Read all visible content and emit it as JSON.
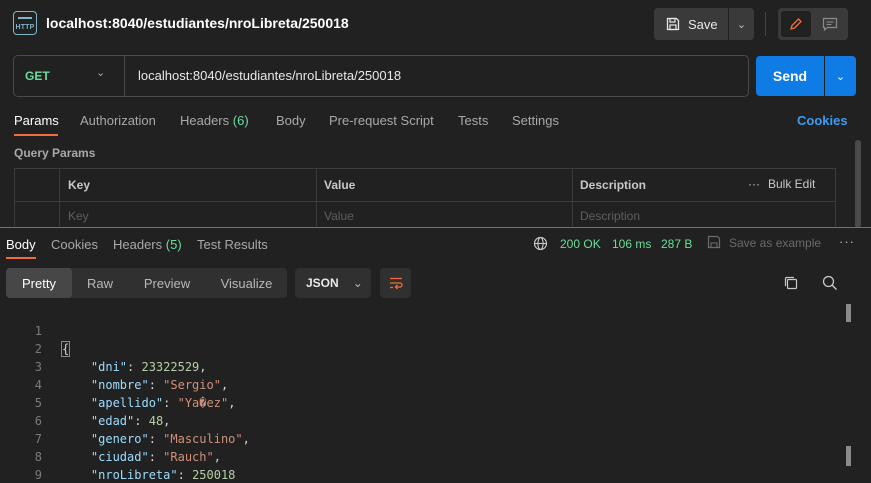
{
  "header": {
    "title": "localhost:8040/estudiantes/nroLibreta/250018",
    "save_label": "Save"
  },
  "request": {
    "method": "GET",
    "url": "localhost:8040/estudiantes/nroLibreta/250018",
    "send_label": "Send"
  },
  "request_tabs": {
    "params": "Params",
    "authorization": "Authorization",
    "headers": "Headers",
    "headers_count": "(6)",
    "body": "Body",
    "prerequest": "Pre-request Script",
    "tests": "Tests",
    "settings": "Settings",
    "cookies": "Cookies"
  },
  "query_params": {
    "label": "Query Params",
    "columns": {
      "key": "Key",
      "value": "Value",
      "description": "Description"
    },
    "bulk_edit": "Bulk Edit",
    "placeholders": {
      "key": "Key",
      "value": "Value",
      "description": "Description"
    }
  },
  "response_tabs": {
    "body": "Body",
    "cookies": "Cookies",
    "headers": "Headers",
    "headers_count": "(5)",
    "test_results": "Test Results"
  },
  "response_status": {
    "status": "200 OK",
    "time": "106 ms",
    "size": "287 B",
    "save_example": "Save as example"
  },
  "format": {
    "pretty": "Pretty",
    "raw": "Raw",
    "preview": "Preview",
    "visualize": "Visualize",
    "language": "JSON"
  },
  "response_body": {
    "line_numbers": [
      "1",
      "2",
      "3",
      "4",
      "5",
      "6",
      "7",
      "8",
      "9"
    ],
    "open_brace": "{",
    "close_brace": "}",
    "fields": [
      {
        "key": "\"dni\"",
        "value": "23322529",
        "type": "number",
        "comma": ","
      },
      {
        "key": "\"nombre\"",
        "value": "\"Sergio\"",
        "type": "string",
        "comma": ","
      },
      {
        "key": "\"apellido\"",
        "value": "\"Ya�ez\"",
        "type": "string",
        "comma": ","
      },
      {
        "key": "\"edad\"",
        "value": "48",
        "type": "number",
        "comma": ","
      },
      {
        "key": "\"genero\"",
        "value": "\"Masculino\"",
        "type": "string",
        "comma": ","
      },
      {
        "key": "\"ciudad\"",
        "value": "\"Rauch\"",
        "type": "string",
        "comma": ","
      },
      {
        "key": "\"nroLibreta\"",
        "value": "250018",
        "type": "number",
        "comma": ""
      }
    ]
  },
  "colors": {
    "accent_orange": "#f26b3a",
    "send_blue": "#0f7be5",
    "success_green": "#6bdd9a"
  },
  "icons": {
    "request_type": "http-icon",
    "save": "save-icon",
    "edit": "pencil-icon",
    "comments": "comment-icon",
    "globe": "globe-icon",
    "save_example": "save-example-icon",
    "wrap": "wrap-lines-icon",
    "copy": "copy-icon",
    "search": "search-icon"
  }
}
